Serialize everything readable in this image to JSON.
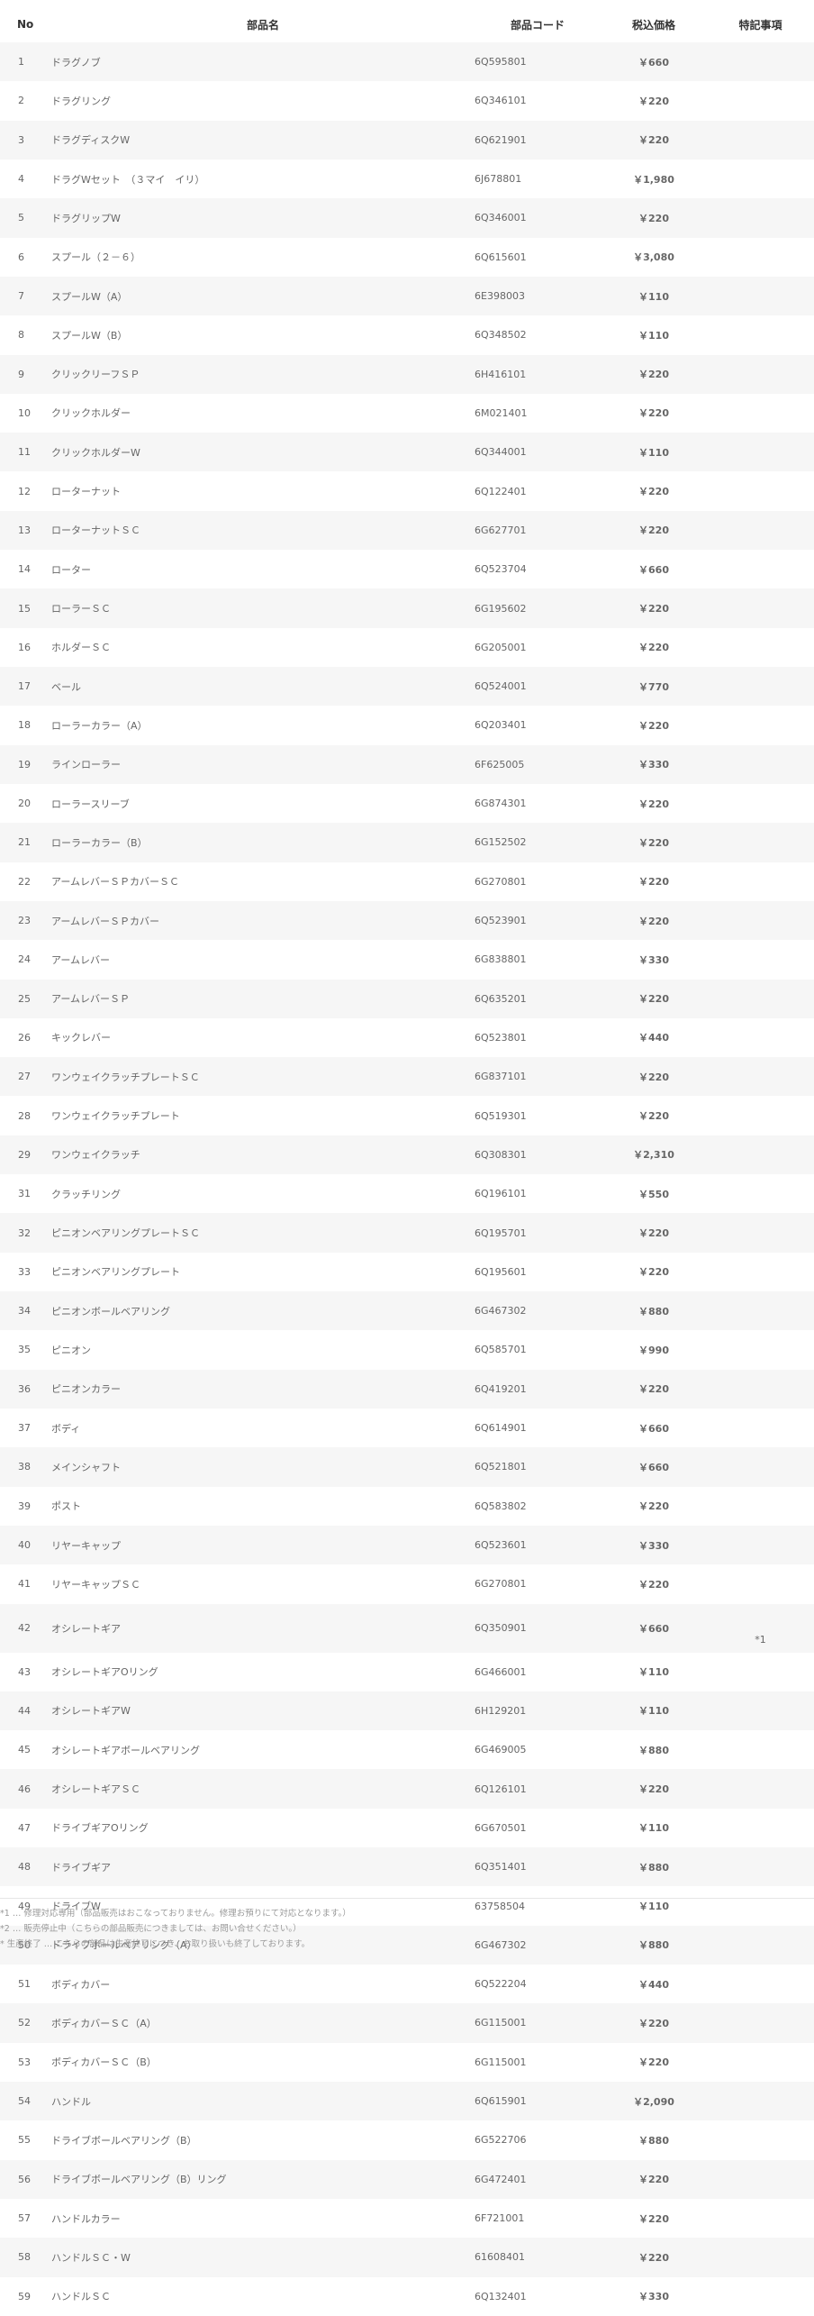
{
  "headers": {
    "no": "No",
    "name": "部品名",
    "code": "部品コード",
    "price": "税込価格",
    "note": "特記事項"
  },
  "rows": [
    {
      "no": "1",
      "name": "ドラグノブ",
      "code": "6Q595801",
      "price": "￥660",
      "note": ""
    },
    {
      "no": "2",
      "name": "ドラグリング",
      "code": "6Q346101",
      "price": "￥220",
      "note": ""
    },
    {
      "no": "3",
      "name": "ドラグディスクW",
      "code": "6Q621901",
      "price": "￥220",
      "note": ""
    },
    {
      "no": "4",
      "name": "ドラグWセット　（３マイ　イリ）",
      "code": "6J678801",
      "price": "￥1,980",
      "note": ""
    },
    {
      "no": "5",
      "name": "ドラグリップW",
      "code": "6Q346001",
      "price": "￥220",
      "note": ""
    },
    {
      "no": "6",
      "name": "スプール（２－６）",
      "code": "6Q615601",
      "price": "￥3,080",
      "note": ""
    },
    {
      "no": "7",
      "name": "スプールW（A）",
      "code": "6E398003",
      "price": "￥110",
      "note": ""
    },
    {
      "no": "8",
      "name": "スプールW（B）",
      "code": "6Q348502",
      "price": "￥110",
      "note": ""
    },
    {
      "no": "9",
      "name": "クリックリーフＳＰ",
      "code": "6H416101",
      "price": "￥220",
      "note": ""
    },
    {
      "no": "10",
      "name": "クリックホルダー",
      "code": "6M021401",
      "price": "￥220",
      "note": ""
    },
    {
      "no": "11",
      "name": "クリックホルダーW",
      "code": "6Q344001",
      "price": "￥110",
      "note": ""
    },
    {
      "no": "12",
      "name": "ローターナット",
      "code": "6Q122401",
      "price": "￥220",
      "note": ""
    },
    {
      "no": "13",
      "name": "ローターナットＳＣ",
      "code": "6G627701",
      "price": "￥220",
      "note": ""
    },
    {
      "no": "14",
      "name": "ローター",
      "code": "6Q523704",
      "price": "￥660",
      "note": ""
    },
    {
      "no": "15",
      "name": "ローラーＳＣ",
      "code": "6G195602",
      "price": "￥220",
      "note": ""
    },
    {
      "no": "16",
      "name": "ホルダーＳＣ",
      "code": "6G205001",
      "price": "￥220",
      "note": ""
    },
    {
      "no": "17",
      "name": "ベール",
      "code": "6Q524001",
      "price": "￥770",
      "note": ""
    },
    {
      "no": "18",
      "name": "ローラーカラー（A）",
      "code": "6Q203401",
      "price": "￥220",
      "note": ""
    },
    {
      "no": "19",
      "name": "ラインローラー",
      "code": "6F625005",
      "price": "￥330",
      "note": ""
    },
    {
      "no": "20",
      "name": "ローラースリーブ",
      "code": "6G874301",
      "price": "￥220",
      "note": ""
    },
    {
      "no": "21",
      "name": "ローラーカラー（B）",
      "code": "6G152502",
      "price": "￥220",
      "note": ""
    },
    {
      "no": "22",
      "name": "アームレバーＳＰカバーＳＣ",
      "code": "6G270801",
      "price": "￥220",
      "note": ""
    },
    {
      "no": "23",
      "name": "アームレバーＳＰカバー",
      "code": "6Q523901",
      "price": "￥220",
      "note": ""
    },
    {
      "no": "24",
      "name": "アームレバー",
      "code": "6G838801",
      "price": "￥330",
      "note": ""
    },
    {
      "no": "25",
      "name": "アームレバーＳＰ",
      "code": "6Q635201",
      "price": "￥220",
      "note": ""
    },
    {
      "no": "26",
      "name": "キックレバー",
      "code": "6Q523801",
      "price": "￥440",
      "note": ""
    },
    {
      "no": "27",
      "name": "ワンウェイクラッチプレートＳＣ",
      "code": "6G837101",
      "price": "￥220",
      "note": ""
    },
    {
      "no": "28",
      "name": "ワンウェイクラッチプレート",
      "code": "6Q519301",
      "price": "￥220",
      "note": ""
    },
    {
      "no": "29",
      "name": "ワンウェイクラッチ",
      "code": "6Q308301",
      "price": "￥2,310",
      "note": ""
    },
    {
      "no": "31",
      "name": "クラッチリング",
      "code": "6Q196101",
      "price": "￥550",
      "note": ""
    },
    {
      "no": "32",
      "name": "ピニオンベアリングプレートＳＣ",
      "code": "6Q195701",
      "price": "￥220",
      "note": ""
    },
    {
      "no": "33",
      "name": "ピニオンベアリングプレート",
      "code": "6Q195601",
      "price": "￥220",
      "note": ""
    },
    {
      "no": "34",
      "name": "ピニオンボールベアリング",
      "code": "6G467302",
      "price": "￥880",
      "note": ""
    },
    {
      "no": "35",
      "name": "ピニオン",
      "code": "6Q585701",
      "price": "￥990",
      "note": ""
    },
    {
      "no": "36",
      "name": "ピニオンカラー",
      "code": "6Q419201",
      "price": "￥220",
      "note": ""
    },
    {
      "no": "37",
      "name": "ボディ",
      "code": "6Q614901",
      "price": "￥660",
      "note": ""
    },
    {
      "no": "38",
      "name": "メインシャフト",
      "code": "6Q521801",
      "price": "￥660",
      "note": ""
    },
    {
      "no": "39",
      "name": "ポスト",
      "code": "6Q583802",
      "price": "￥220",
      "note": ""
    },
    {
      "no": "40",
      "name": "リヤーキャップ",
      "code": "6Q523601",
      "price": "￥330",
      "note": ""
    },
    {
      "no": "41",
      "name": "リヤーキャップＳＣ",
      "code": "6G270801",
      "price": "￥220",
      "note": ""
    },
    {
      "no": "42",
      "name": "オシレートギア",
      "code": "6Q350901",
      "price": "￥660",
      "note": "*1"
    },
    {
      "no": "43",
      "name": "オシレートギアOリング",
      "code": "6G466001",
      "price": "￥110",
      "note": ""
    },
    {
      "no": "44",
      "name": "オシレートギアW",
      "code": "6H129201",
      "price": "￥110",
      "note": ""
    },
    {
      "no": "45",
      "name": "オシレートギアボールベアリング",
      "code": "6G469005",
      "price": "￥880",
      "note": ""
    },
    {
      "no": "46",
      "name": "オシレートギアＳＣ",
      "code": "6Q126101",
      "price": "￥220",
      "note": ""
    },
    {
      "no": "47",
      "name": "ドライブギアOリング",
      "code": "6G670501",
      "price": "￥110",
      "note": ""
    },
    {
      "no": "48",
      "name": "ドライブギア",
      "code": "6Q351401",
      "price": "￥880",
      "note": ""
    },
    {
      "no": "49",
      "name": "ドライブW",
      "code": "63758504",
      "price": "￥110",
      "note": ""
    },
    {
      "no": "50",
      "name": "ドライブボールベアリング（A）",
      "code": "6G467302",
      "price": "￥880",
      "note": ""
    },
    {
      "no": "51",
      "name": "ボディカバー",
      "code": "6Q522204",
      "price": "￥440",
      "note": ""
    },
    {
      "no": "52",
      "name": "ボディカバーＳＣ（A）",
      "code": "6G115001",
      "price": "￥220",
      "note": ""
    },
    {
      "no": "53",
      "name": "ボディカバーＳＣ（B）",
      "code": "6G115001",
      "price": "￥220",
      "note": ""
    },
    {
      "no": "54",
      "name": "ハンドル",
      "code": "6Q615901",
      "price": "￥2,090",
      "note": ""
    },
    {
      "no": "55",
      "name": "ドライブボールベアリング（B）",
      "code": "6G522706",
      "price": "￥880",
      "note": ""
    },
    {
      "no": "56",
      "name": "ドライブボールベアリング（B）リング",
      "code": "6G472401",
      "price": "￥220",
      "note": ""
    },
    {
      "no": "57",
      "name": "ハンドルカラー",
      "code": "6F721001",
      "price": "￥220",
      "note": ""
    },
    {
      "no": "58",
      "name": "ハンドルＳＣ・W",
      "code": "61608401",
      "price": "￥220",
      "note": ""
    },
    {
      "no": "59",
      "name": "ハンドルＳＣ",
      "code": "6Q132401",
      "price": "￥330",
      "note": ""
    }
  ],
  "footnotes": [
    "*1 … 修理対応専用（部品販売はおこなっておりません。修理お預りにて対応となります。）",
    "*2 … 販売停止中（こちらの部品販売につきましては、お問い合せください。）",
    "* 生産終了 … こちらの部品は生産終了につき、お取り扱いも終了しております。"
  ]
}
